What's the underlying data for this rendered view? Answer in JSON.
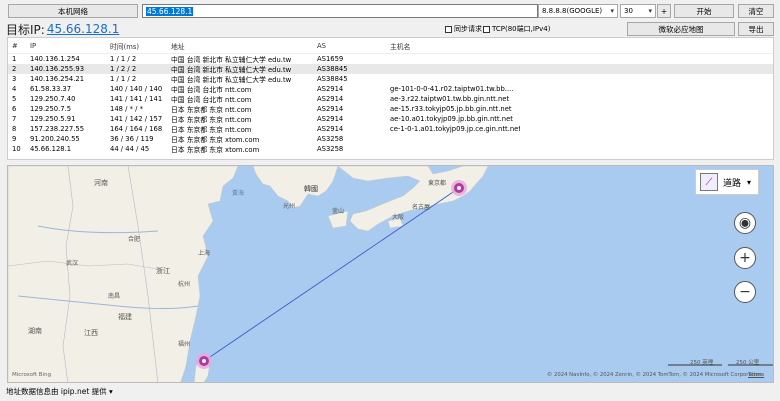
{
  "toolbar": {
    "local_net_label": "本机网络",
    "target_input_value": "45.66.128.1",
    "dns_select_value": "8.8.8.8(GOOGLE)",
    "max_hops_value": "30",
    "plus_label": "+",
    "start_label": "开始",
    "clear_label": "清空",
    "bing_map_label": "微软必应地图",
    "export_label": "导出"
  },
  "target": {
    "label": "目标IP:",
    "ip": "45.66.128.1"
  },
  "options": {
    "sync_request": "同步请求",
    "tcp_option": "TCP(80端口,IPv4)"
  },
  "table": {
    "headers": [
      "#",
      "IP",
      "时间(ms)",
      "地址",
      "AS",
      "主机名"
    ],
    "rows": [
      [
        "1",
        "140.136.1.254",
        "1 / 1 / 2",
        "中国 台湾 新北市 私立辅仁大学 edu.tw",
        "AS1659",
        ""
      ],
      [
        "2",
        "140.136.255.93",
        "1 / 2 / 2",
        "中国 台湾 新北市 私立辅仁大学 edu.tw",
        "AS38845",
        ""
      ],
      [
        "3",
        "140.136.254.21",
        "1 / 1 / 2",
        "中国 台湾 新北市 私立辅仁大学 edu.tw",
        "AS38845",
        ""
      ],
      [
        "4",
        "61.58.33.37",
        "140 / 140 / 140",
        "中国 台湾 台北市 ntt.com",
        "AS2914",
        "ge-101-0-0-41.r02.taiptw01.tw.bb...."
      ],
      [
        "5",
        "129.250.7.40",
        "141 / 141 / 141",
        "中国 台湾 台北市 ntt.com",
        "AS2914",
        "ae-3.r22.taiptw01.tw.bb.gin.ntt.net"
      ],
      [
        "6",
        "129.250.7.5",
        "148 / * / *",
        "日本 东京都 东京 ntt.com",
        "AS2914",
        "ae-15.r33.tokyjp05.jp.bb.gin.ntt.net"
      ],
      [
        "7",
        "129.250.5.91",
        "141 / 142 / 157",
        "日本 东京都 东京 ntt.com",
        "AS2914",
        "ae-10.a01.tokyjp09.jp.bb.gin.ntt.net"
      ],
      [
        "8",
        "157.238.227.55",
        "164 / 164 / 168",
        "日本 东京都 东京 ntt.com",
        "AS2914",
        "ce-1-0-1.a01.tokyjp09.jp.ce.gin.ntt.net"
      ],
      [
        "9",
        "91.200.240.55",
        "36 / 36 / 119",
        "日本 东京都 东京 xtom.com",
        "AS3258",
        ""
      ],
      [
        "10",
        "45.66.128.1",
        "44 / 44 / 45",
        "日本 东京都 东京 xtom.com",
        "AS3258",
        ""
      ]
    ]
  },
  "map": {
    "road_label": "道路",
    "labels": {
      "korea": "韓國",
      "busan": "釜山",
      "guangzhou": "光州",
      "osaka": "大阪",
      "nagoya": "名古屋",
      "tokyo": "東京都",
      "yellow_sea": "黃海",
      "shanghai": "上海",
      "hangzhou": "杭州",
      "fuzhou": "福州",
      "nanchang": "南昌",
      "hefei": "合肥",
      "wuhan": "武汉",
      "henan": "河南",
      "hunan": "湖南",
      "jiangxi": "江西",
      "fujian": "福建",
      "zhejiang": "浙江"
    },
    "scale_left": "250 英哩",
    "scale_right": "250 公里",
    "copyright": "© 2024 NavInfo, © 2024 Zenrin, © 2024 TomTom, © 2024 Microsoft Corporation",
    "terms": "Terms",
    "logo": "Microsoft Bing"
  },
  "status": {
    "text": "地址数据信息由 ipip.net 提供 ▾"
  },
  "colors": {
    "link_blue": "#1a6fc4",
    "hop_marker": "#b03aa0",
    "route_line": "#3a5fd0",
    "sea": "#a9cbef",
    "land": "#f2efe6"
  }
}
